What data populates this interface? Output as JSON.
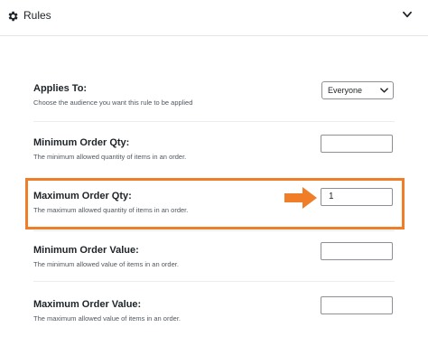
{
  "header": {
    "title": "Rules"
  },
  "rules": {
    "applies_to": {
      "label": "Applies To:",
      "description": "Choose the audience you want this rule to be applied",
      "selected": "Everyone"
    },
    "min_qty": {
      "label": "Minimum Order Qty:",
      "description": "The minimum allowed quantity of items in an order.",
      "value": ""
    },
    "max_qty": {
      "label": "Maximum Order Qty:",
      "description": "The maximum allowed quantity of items in an order.",
      "value": "1"
    },
    "min_value": {
      "label": "Minimum Order Value:",
      "description": "The minimum allowed value of items in an order.",
      "value": ""
    },
    "max_value": {
      "label": "Maximum Order Value:",
      "description": "The maximum allowed value of items in an order.",
      "value": ""
    }
  },
  "colors": {
    "highlight": "#f07d28",
    "text": "#1d2327",
    "muted": "#50575e",
    "border": "#8c8f94"
  },
  "icons": {
    "header": "gear-icon",
    "collapse": "chevron-down-icon",
    "callout": "arrow-right-icon"
  }
}
